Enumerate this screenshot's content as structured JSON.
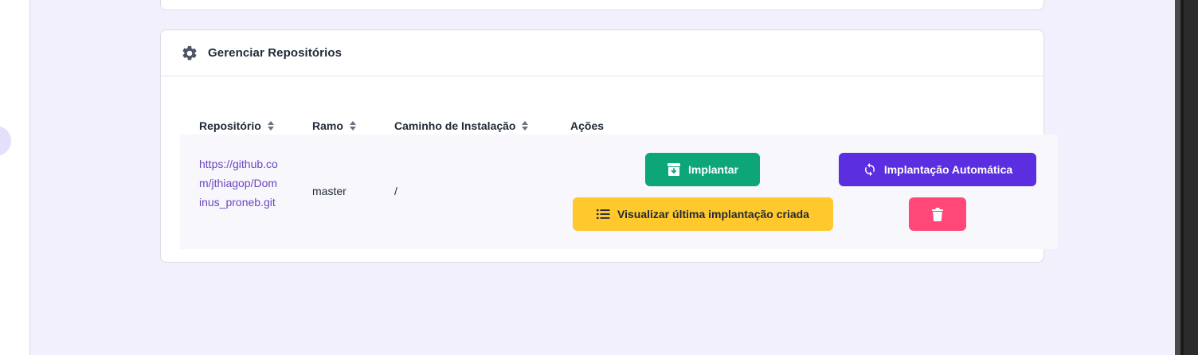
{
  "panel": {
    "title": "Gerenciar Repositórios",
    "icon": "gear-icon"
  },
  "table": {
    "columns": [
      {
        "label": "Repositório",
        "sortable": true
      },
      {
        "label": "Ramo",
        "sortable": true
      },
      {
        "label": "Caminho de Instalação",
        "sortable": true
      },
      {
        "label": "Ações",
        "sortable": false
      }
    ],
    "rows": [
      {
        "repository": "https://github.com/jthiagop/Dominus_proneb.git",
        "branch": "master",
        "path": "/",
        "actions": {
          "deploy_label": "Implantar",
          "auto_deploy_label": "Implantação Automática",
          "view_last_label": "Visualizar última implantação criada",
          "delete_icon": "trash-icon"
        }
      }
    ]
  },
  "colors": {
    "background": "#f1f0fc",
    "deploy": "#0ca678",
    "auto_deploy": "#5b2ee0",
    "view_last": "#ffc82c",
    "delete": "#ff4778",
    "link": "#6b46c1"
  }
}
